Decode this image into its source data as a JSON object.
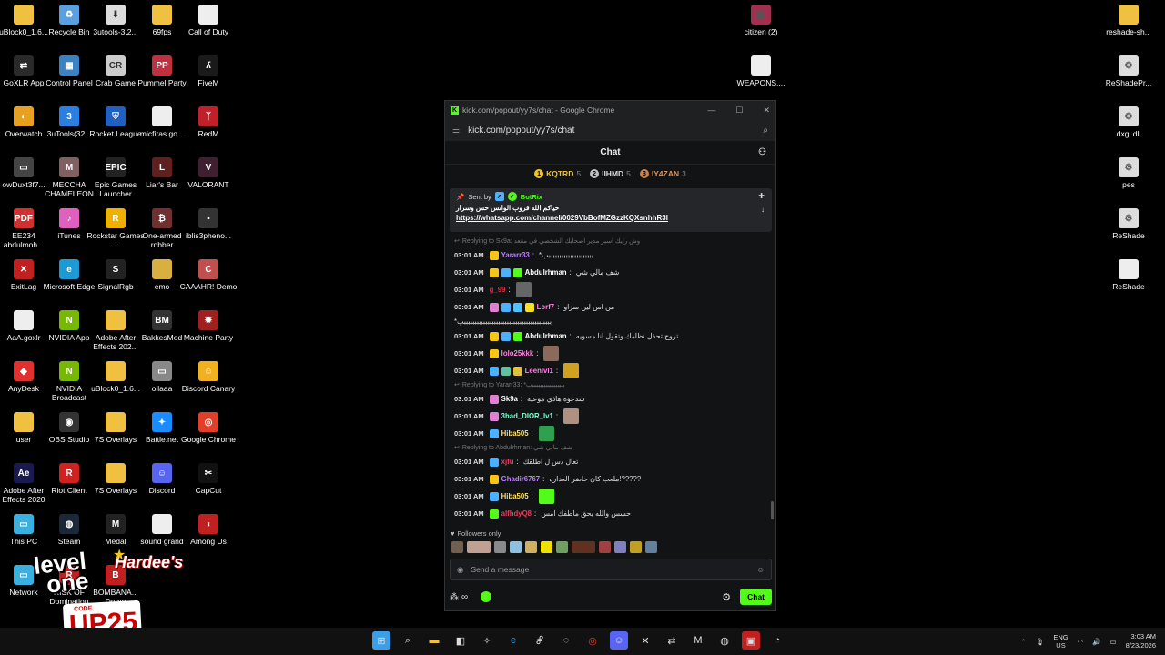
{
  "desktop": {
    "icons": [
      {
        "label": "uBlock0_1.6...",
        "color": "#f0c040",
        "glyph": ""
      },
      {
        "label": "Recycle Bin",
        "color": "#5aa0e0",
        "glyph": "♻"
      },
      {
        "label": "3utools-3.2...",
        "color": "#ddd",
        "glyph": "⬇"
      },
      {
        "label": "69fps",
        "color": "#f0c040",
        "glyph": ""
      },
      {
        "label": "Call of Duty",
        "color": "#eee",
        "glyph": ""
      },
      {
        "label": "GoXLR App",
        "color": "#2a2a2a",
        "glyph": "⇄"
      },
      {
        "label": "Control Panel",
        "color": "#3b82c4",
        "glyph": "▦"
      },
      {
        "label": "Crab Game",
        "color": "#ccc",
        "glyph": "CR"
      },
      {
        "label": "Pummel Party",
        "color": "#c03040",
        "glyph": "PP"
      },
      {
        "label": "FiveM",
        "color": "#1a1a1a",
        "glyph": "ʎ"
      },
      {
        "label": "Overwatch",
        "color": "#e8a020",
        "glyph": "◐"
      },
      {
        "label": "3uTools(32...",
        "color": "#2b7fe0",
        "glyph": "3"
      },
      {
        "label": "Rocket League",
        "color": "#2060c0",
        "glyph": "⛨"
      },
      {
        "label": "micfiras.go...",
        "color": "#eee",
        "glyph": ""
      },
      {
        "label": "RedM",
        "color": "#c0202a",
        "glyph": "ᛉ"
      },
      {
        "label": "owDuxt3f7...",
        "color": "#444",
        "glyph": "▭"
      },
      {
        "label": "MECCHA CHAMELEON",
        "color": "#806060",
        "glyph": "M"
      },
      {
        "label": "Epic Games Launcher",
        "color": "#222",
        "glyph": "EPIC"
      },
      {
        "label": "Liar's Bar",
        "color": "#602020",
        "glyph": "L"
      },
      {
        "label": "VALORANT",
        "color": "#402030",
        "glyph": "V"
      },
      {
        "label": "EE234 abdulmoh...",
        "color": "#d03030",
        "glyph": "PDF"
      },
      {
        "label": "iTunes",
        "color": "#e060c0",
        "glyph": "♪"
      },
      {
        "label": "Rockstar Games ...",
        "color": "#f0b000",
        "glyph": "R"
      },
      {
        "label": "One-armed robber",
        "color": "#703030",
        "glyph": "₿"
      },
      {
        "label": "iblis3pheno...",
        "color": "#333",
        "glyph": "▪"
      },
      {
        "label": "ExitLag",
        "color": "#c02020",
        "glyph": "✕"
      },
      {
        "label": "Microsoft Edge",
        "color": "#1c9ad6",
        "glyph": "e"
      },
      {
        "label": "SignalRgb",
        "color": "#222",
        "glyph": "S"
      },
      {
        "label": "emo",
        "color": "#d8b040",
        "glyph": ""
      },
      {
        "label": "CAAAHR! Demo",
        "color": "#c05050",
        "glyph": "C"
      },
      {
        "label": "AaA.goxlr",
        "color": "#eee",
        "glyph": ""
      },
      {
        "label": "NVIDIA App",
        "color": "#76b900",
        "glyph": "N"
      },
      {
        "label": "Adobe After Effects 202...",
        "color": "#f0c040",
        "glyph": ""
      },
      {
        "label": "BakkesMod",
        "color": "#333",
        "glyph": "BM"
      },
      {
        "label": "Machine Party",
        "color": "#a02020",
        "glyph": "✹"
      },
      {
        "label": "AnyDesk",
        "color": "#e03030",
        "glyph": "◆"
      },
      {
        "label": "NVIDIA Broadcast",
        "color": "#76b900",
        "glyph": "N"
      },
      {
        "label": "uBlock0_1.6...",
        "color": "#f0c040",
        "glyph": ""
      },
      {
        "label": "ollaaa",
        "color": "#888",
        "glyph": "▭"
      },
      {
        "label": "Discord Canary",
        "color": "#f0b020",
        "glyph": "☺"
      },
      {
        "label": "user",
        "color": "#f0c040",
        "glyph": ""
      },
      {
        "label": "OBS Studio",
        "color": "#333",
        "glyph": "◉"
      },
      {
        "label": "7S Overlays",
        "color": "#f0c040",
        "glyph": ""
      },
      {
        "label": "Battle.net",
        "color": "#1a8cff",
        "glyph": "✦"
      },
      {
        "label": "Google Chrome",
        "color": "#e0402a",
        "glyph": "◎"
      },
      {
        "label": "Adobe After Effects 2020",
        "color": "#1a1a50",
        "glyph": "Ae"
      },
      {
        "label": "Riot Client",
        "color": "#d02020",
        "glyph": "R"
      },
      {
        "label": "7S Overlays",
        "color": "#f0c040",
        "glyph": ""
      },
      {
        "label": "Discord",
        "color": "#5865f2",
        "glyph": "☺"
      },
      {
        "label": "CapCut",
        "color": "#111",
        "glyph": "✂"
      },
      {
        "label": "This PC",
        "color": "#3ab0e0",
        "glyph": "▭"
      },
      {
        "label": "Steam",
        "color": "#1b2838",
        "glyph": "◍"
      },
      {
        "label": "Medal",
        "color": "#222",
        "glyph": "M"
      },
      {
        "label": "sound grand",
        "color": "#eee",
        "glyph": ""
      },
      {
        "label": "Among Us",
        "color": "#c02020",
        "glyph": "◖"
      },
      {
        "label": "Network",
        "color": "#3ab0e0",
        "glyph": "▭"
      },
      {
        "label": "RISK OF Domination",
        "color": "#c02020",
        "glyph": "R"
      },
      {
        "label": "BOMBANA... Demo",
        "color": "#c02020",
        "glyph": "B"
      }
    ],
    "right_icons": [
      {
        "label": "citizen (2)",
        "color": "#a03050",
        "glyph": "▦"
      },
      {
        "label": "WEAPONS....",
        "color": "#eee",
        "glyph": ""
      },
      {
        "label": "reshade-sh...",
        "color": "#f0c040",
        "glyph": ""
      },
      {
        "label": "ReShadePr...",
        "color": "#ddd",
        "glyph": "⚙"
      },
      {
        "label": "dxgi.dll",
        "color": "#ddd",
        "glyph": "⚙"
      },
      {
        "label": "pes",
        "color": "#ddd",
        "glyph": "⚙"
      },
      {
        "label": "ReShade",
        "color": "#ddd",
        "glyph": "⚙"
      },
      {
        "label": "ReShade",
        "color": "#eee",
        "glyph": ""
      }
    ]
  },
  "window": {
    "title": "kick.com/popout/yy7s/chat - Google Chrome",
    "url": "kick.com/popout/yy7s/chat",
    "chat_title": "Chat",
    "leaders": [
      {
        "rank": "1",
        "name": "KQTRD",
        "count": "5",
        "color": "#f5c518"
      },
      {
        "rank": "2",
        "name": "IIHMD",
        "count": "5",
        "color": "#c0c0c0"
      },
      {
        "rank": "3",
        "name": "IY4ZAN",
        "count": "3",
        "color": "#d08040"
      }
    ],
    "pinned": {
      "sent_by_label": "Sent by",
      "sender": "BotRix",
      "message": "حياكم الله قروب الواتس حس وسزار",
      "link": "https://whatsapp.com/channel/0029VbBofMZGzzKQXsnhhR3l"
    },
    "messages": [
      {
        "type": "reply",
        "text": "Replying to Sk9a: وش رايك اسير مدير اصحابك الشخصي في مقعد"
      },
      {
        "time": "03:01 AM",
        "badges": [
          "#f5c518"
        ],
        "user": "Yararr33",
        "ucolor": "#c080ff",
        "text": "*بببببببببببببببببببببب"
      },
      {
        "time": "03:01 AM",
        "badges": [
          "#f5c518",
          "#4ab0ff",
          "#53fc18"
        ],
        "user": "Abdulrhman",
        "ucolor": "#ffffff",
        "text": "شف مالي شي"
      },
      {
        "time": "03:01 AM",
        "badges": [],
        "user": "g_99",
        "ucolor": "#e03040",
        "text": "",
        "emote": "#666"
      },
      {
        "time": "03:01 AM",
        "badges": [
          "#e080d0",
          "#4ab0ff",
          "#53c0ff",
          "#f5e020"
        ],
        "user": "Lorf7",
        "ucolor": "#ff80e0",
        "text": "من اس لين سزاو"
      },
      {
        "type": "cont",
        "text": "*بببببببببببببببببببببببببببببببببببببببببب"
      },
      {
        "time": "03:01 AM",
        "badges": [
          "#f5c518",
          "#4ab0ff",
          "#53fc18"
        ],
        "user": "Abdulrhman",
        "ucolor": "#ffffff",
        "text": "تروح تحذل نظامك وتقول انا مسويه"
      },
      {
        "time": "03:01 AM",
        "badges": [
          "#f5c518"
        ],
        "user": "lolo25kkk",
        "ucolor": "#ff80e0",
        "text": "",
        "emote": "#8a6a5a"
      },
      {
        "time": "03:01 AM",
        "badges": [
          "#4ab0ff",
          "#60c0a0",
          "#e0c040"
        ],
        "user": "Leenlvl1",
        "ucolor": "#ff80e0",
        "text": "",
        "emote": "#d0a020"
      },
      {
        "type": "reply",
        "text": "Replying to Yararr33: *بببببببببببببببببب"
      },
      {
        "time": "03:01 AM",
        "badges": [
          "#e080d0"
        ],
        "user": "Sk9a",
        "ucolor": "#ffffff",
        "text": "شدعوه هاذي موعيه"
      },
      {
        "time": "03:01 AM",
        "badges": [
          "#e080d0"
        ],
        "user": "3had_DIOR_lv1",
        "ucolor": "#80ffd0",
        "text": "",
        "emote": "#b09080"
      },
      {
        "time": "03:01 AM",
        "badges": [
          "#4ab0ff"
        ],
        "user": "Hiba505",
        "ucolor": "#ffe060",
        "text": "",
        "emote": "#30a050"
      },
      {
        "type": "reply",
        "text": "Replying to Abdulrhman: شف مالي شي"
      },
      {
        "time": "03:01 AM",
        "badges": [
          "#4ab0ff"
        ],
        "user": "xjfu",
        "ucolor": "#e04060",
        "text": "تعال دس ل اطلقك"
      },
      {
        "time": "03:01 AM",
        "badges": [
          "#f5c518"
        ],
        "user": "Ghadir6767",
        "ucolor": "#c080ff",
        "text": "ملعب كان حاضر العداره!?????"
      },
      {
        "time": "03:01 AM",
        "badges": [
          "#4ab0ff"
        ],
        "user": "Hiba505",
        "ucolor": "#ffe060",
        "text": "",
        "emote": "#53fc18"
      },
      {
        "time": "03:01 AM",
        "badges": [
          "#53fc18"
        ],
        "user": "alfhdyQ8",
        "ucolor": "#e04060",
        "text": "حسس والله بحق ماطفك امس"
      }
    ],
    "followers_only": "Followers only",
    "emote_colors": [
      "#706050",
      "#c0a090",
      "#8a8a8a",
      "#90c0e0",
      "#d0b060",
      "#f0e000",
      "#70a060",
      "#603020",
      "#a04040",
      "#8080c0",
      "#c0a020",
      "#6080a0"
    ],
    "input_placeholder": "Send a message",
    "chat_button": "Chat",
    "counter": "∞"
  },
  "taskbar": {
    "icons": [
      {
        "name": "start-icon",
        "color": "#3a9fe8",
        "glyph": "⊞"
      },
      {
        "name": "search-icon",
        "color": "#111",
        "glyph": "⌕"
      },
      {
        "name": "file-explorer-icon",
        "color": "#111",
        "glyph": "▬"
      },
      {
        "name": "store-icon",
        "color": "#111",
        "glyph": "◧"
      },
      {
        "name": "copilot-icon",
        "color": "#111",
        "glyph": "✧"
      },
      {
        "name": "edge-icon",
        "color": "#111",
        "glyph": "e"
      },
      {
        "name": "3utools-icon",
        "color": "#111",
        "glyph": "Ⴥ"
      },
      {
        "name": "app-icon",
        "color": "#111",
        "glyph": "◌"
      },
      {
        "name": "chrome-icon",
        "color": "#111",
        "glyph": "◎"
      },
      {
        "name": "discord-icon",
        "color": "#5865f2",
        "glyph": "☺"
      },
      {
        "name": "exitlag-icon",
        "color": "#111",
        "glyph": "✕"
      },
      {
        "name": "goxlr-icon",
        "color": "#111",
        "glyph": "⇄"
      },
      {
        "name": "medal-icon",
        "color": "#111",
        "glyph": "M"
      },
      {
        "name": "steam-icon",
        "color": "#111",
        "glyph": "◍"
      },
      {
        "name": "red-app-icon",
        "color": "#c02020",
        "glyph": "▣"
      },
      {
        "name": "overlay-icon",
        "color": "#111",
        "glyph": "◔"
      }
    ],
    "lang_top": "ENG",
    "lang_bottom": "US",
    "time": "3:03 AM",
    "date": "8/23/2026"
  },
  "sponsor": {
    "brand_top": "level",
    "brand_bottom": "one",
    "restaurant": "Hardee's",
    "code_label": "CODE",
    "code": "UP25"
  }
}
